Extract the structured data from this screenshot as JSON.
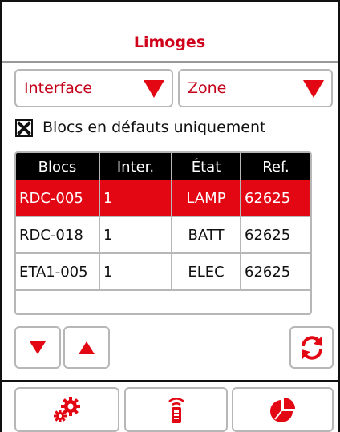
{
  "header": {
    "title": "Limoges"
  },
  "filters": {
    "interface": {
      "label": "Interface"
    },
    "zone": {
      "label": "Zone"
    }
  },
  "checkbox": {
    "label": "Blocs en défauts uniquement",
    "checked": true
  },
  "table": {
    "columns": [
      "Blocs",
      "Inter.",
      "État",
      "Ref."
    ],
    "rows": [
      {
        "blocs": "RDC-005",
        "inter": "1",
        "etat": "LAMP",
        "ref": "62625",
        "selected": true
      },
      {
        "blocs": "RDC-018",
        "inter": "1",
        "etat": "BATT",
        "ref": "62625",
        "selected": false
      },
      {
        "blocs": "ETA1-005",
        "inter": "1",
        "etat": "ELEC",
        "ref": "62625",
        "selected": false
      }
    ]
  },
  "icons": {
    "dropdown": "triangle-down-icon",
    "scroll_down": "triangle-down-icon",
    "scroll_up": "triangle-up-icon",
    "refresh": "refresh-icon",
    "settings": "gears-icon",
    "remote": "remote-control-icon",
    "stats": "pie-chart-icon"
  },
  "colors": {
    "accent": "#e30613",
    "title": "#d0021b",
    "header_bg": "#000000",
    "border": "#b7b7b7"
  }
}
